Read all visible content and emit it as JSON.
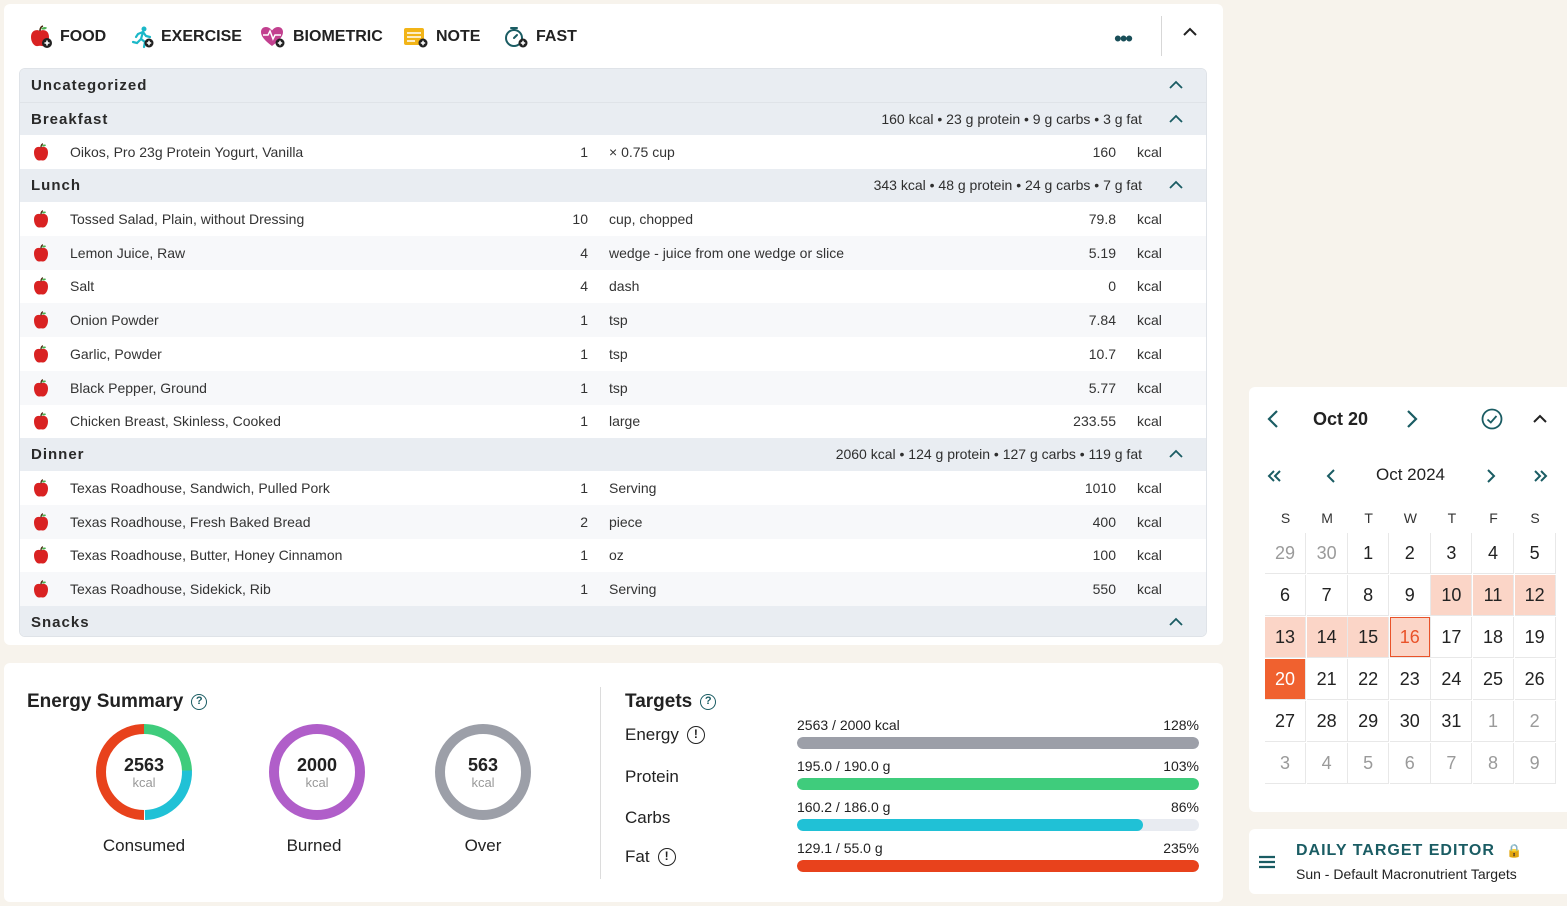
{
  "toolbar": {
    "food": "FOOD",
    "exercise": "EXERCISE",
    "biometric": "BIOMETRIC",
    "note": "NOTE",
    "fast": "FAST",
    "more": "•••"
  },
  "diary": {
    "uncategorized": "Uncategorized",
    "breakfast": {
      "label": "Breakfast",
      "summary": "160 kcal • 23 g protein • 9 g carbs • 3 g fat",
      "items": [
        {
          "name": "Oikos, Pro 23g Protein Yogurt, Vanilla",
          "qty": "1",
          "unit": "× 0.75 cup",
          "kcal": "160",
          "kunit": "kcal"
        }
      ]
    },
    "lunch": {
      "label": "Lunch",
      "summary": "343 kcal • 48 g protein • 24 g carbs • 7 g fat",
      "items": [
        {
          "name": "Tossed Salad, Plain, without Dressing",
          "qty": "10",
          "unit": "cup, chopped",
          "kcal": "79.8",
          "kunit": "kcal"
        },
        {
          "name": "Lemon Juice, Raw",
          "qty": "4",
          "unit": "wedge - juice from one wedge or slice",
          "kcal": "5.19",
          "kunit": "kcal"
        },
        {
          "name": "Salt",
          "qty": "4",
          "unit": "dash",
          "kcal": "0",
          "kunit": "kcal"
        },
        {
          "name": "Onion Powder",
          "qty": "1",
          "unit": "tsp",
          "kcal": "7.84",
          "kunit": "kcal"
        },
        {
          "name": "Garlic, Powder",
          "qty": "1",
          "unit": "tsp",
          "kcal": "10.7",
          "kunit": "kcal"
        },
        {
          "name": "Black Pepper, Ground",
          "qty": "1",
          "unit": "tsp",
          "kcal": "5.77",
          "kunit": "kcal"
        },
        {
          "name": "Chicken Breast, Skinless, Cooked",
          "qty": "1",
          "unit": "large",
          "kcal": "233.55",
          "kunit": "kcal"
        }
      ]
    },
    "dinner": {
      "label": "Dinner",
      "summary": "2060 kcal • 124 g protein • 127 g carbs • 119 g fat",
      "items": [
        {
          "name": "Texas Roadhouse, Sandwich, Pulled Pork",
          "qty": "1",
          "unit": "Serving",
          "kcal": "1010",
          "kunit": "kcal"
        },
        {
          "name": "Texas Roadhouse, Fresh Baked Bread",
          "qty": "2",
          "unit": "piece",
          "kcal": "400",
          "kunit": "kcal"
        },
        {
          "name": "Texas Roadhouse, Butter, Honey Cinnamon",
          "qty": "1",
          "unit": "oz",
          "kcal": "100",
          "kunit": "kcal"
        },
        {
          "name": "Texas Roadhouse, Sidekick, Rib",
          "qty": "1",
          "unit": "Serving",
          "kcal": "550",
          "kunit": "kcal"
        }
      ]
    },
    "snacks": "Snacks"
  },
  "energy": {
    "title": "Energy Summary",
    "help": "?",
    "consumed": {
      "value": "2563",
      "unit": "kcal",
      "label": "Consumed"
    },
    "burned": {
      "value": "2000",
      "unit": "kcal",
      "label": "Burned"
    },
    "over": {
      "value": "563",
      "unit": "kcal",
      "label": "Over"
    },
    "colors": {
      "red": "#e8421c",
      "green": "#3fcc7c",
      "cyan": "#20c1d6",
      "purple": "#b05ec9",
      "gray": "#9c9fa8"
    }
  },
  "targets": {
    "title": "Targets",
    "help": "?",
    "info": "!",
    "rows": [
      {
        "label": "Energy",
        "text": "2563 / 2000 kcal",
        "pct": "128%",
        "fill": 1.0,
        "color": "#9c9fa8"
      },
      {
        "label": "Protein",
        "text": "195.0 / 190.0 g",
        "pct": "103%",
        "fill": 1.0,
        "color": "#3fcc7c"
      },
      {
        "label": "Carbs",
        "text": "160.2 / 186.0 g",
        "pct": "86%",
        "fill": 0.86,
        "color": "#20c1d6"
      },
      {
        "label": "Fat",
        "text": "129.1 / 55.0 g",
        "pct": "235%",
        "fill": 1.0,
        "color": "#e8421c"
      }
    ]
  },
  "calendar": {
    "current_date": "Oct 20",
    "month_label": "Oct 2024",
    "weekdays": [
      "S",
      "M",
      "T",
      "W",
      "T",
      "F",
      "S"
    ],
    "weeks": [
      [
        "29",
        "30",
        "1",
        "2",
        "3",
        "4",
        "5"
      ],
      [
        "6",
        "7",
        "8",
        "9",
        "10",
        "11",
        "12"
      ],
      [
        "13",
        "14",
        "15",
        "16",
        "17",
        "18",
        "19"
      ],
      [
        "20",
        "21",
        "22",
        "23",
        "24",
        "25",
        "26"
      ],
      [
        "27",
        "28",
        "29",
        "30",
        "31",
        "1",
        "2"
      ],
      [
        "3",
        "4",
        "5",
        "6",
        "7",
        "8",
        "9"
      ]
    ],
    "accent": "#f0612f",
    "highlight": "#fbd5c7"
  },
  "editor": {
    "title": "DAILY TARGET EDITOR",
    "subtitle": "Sun - Default Macronutrient Targets",
    "lock": "🔒"
  }
}
